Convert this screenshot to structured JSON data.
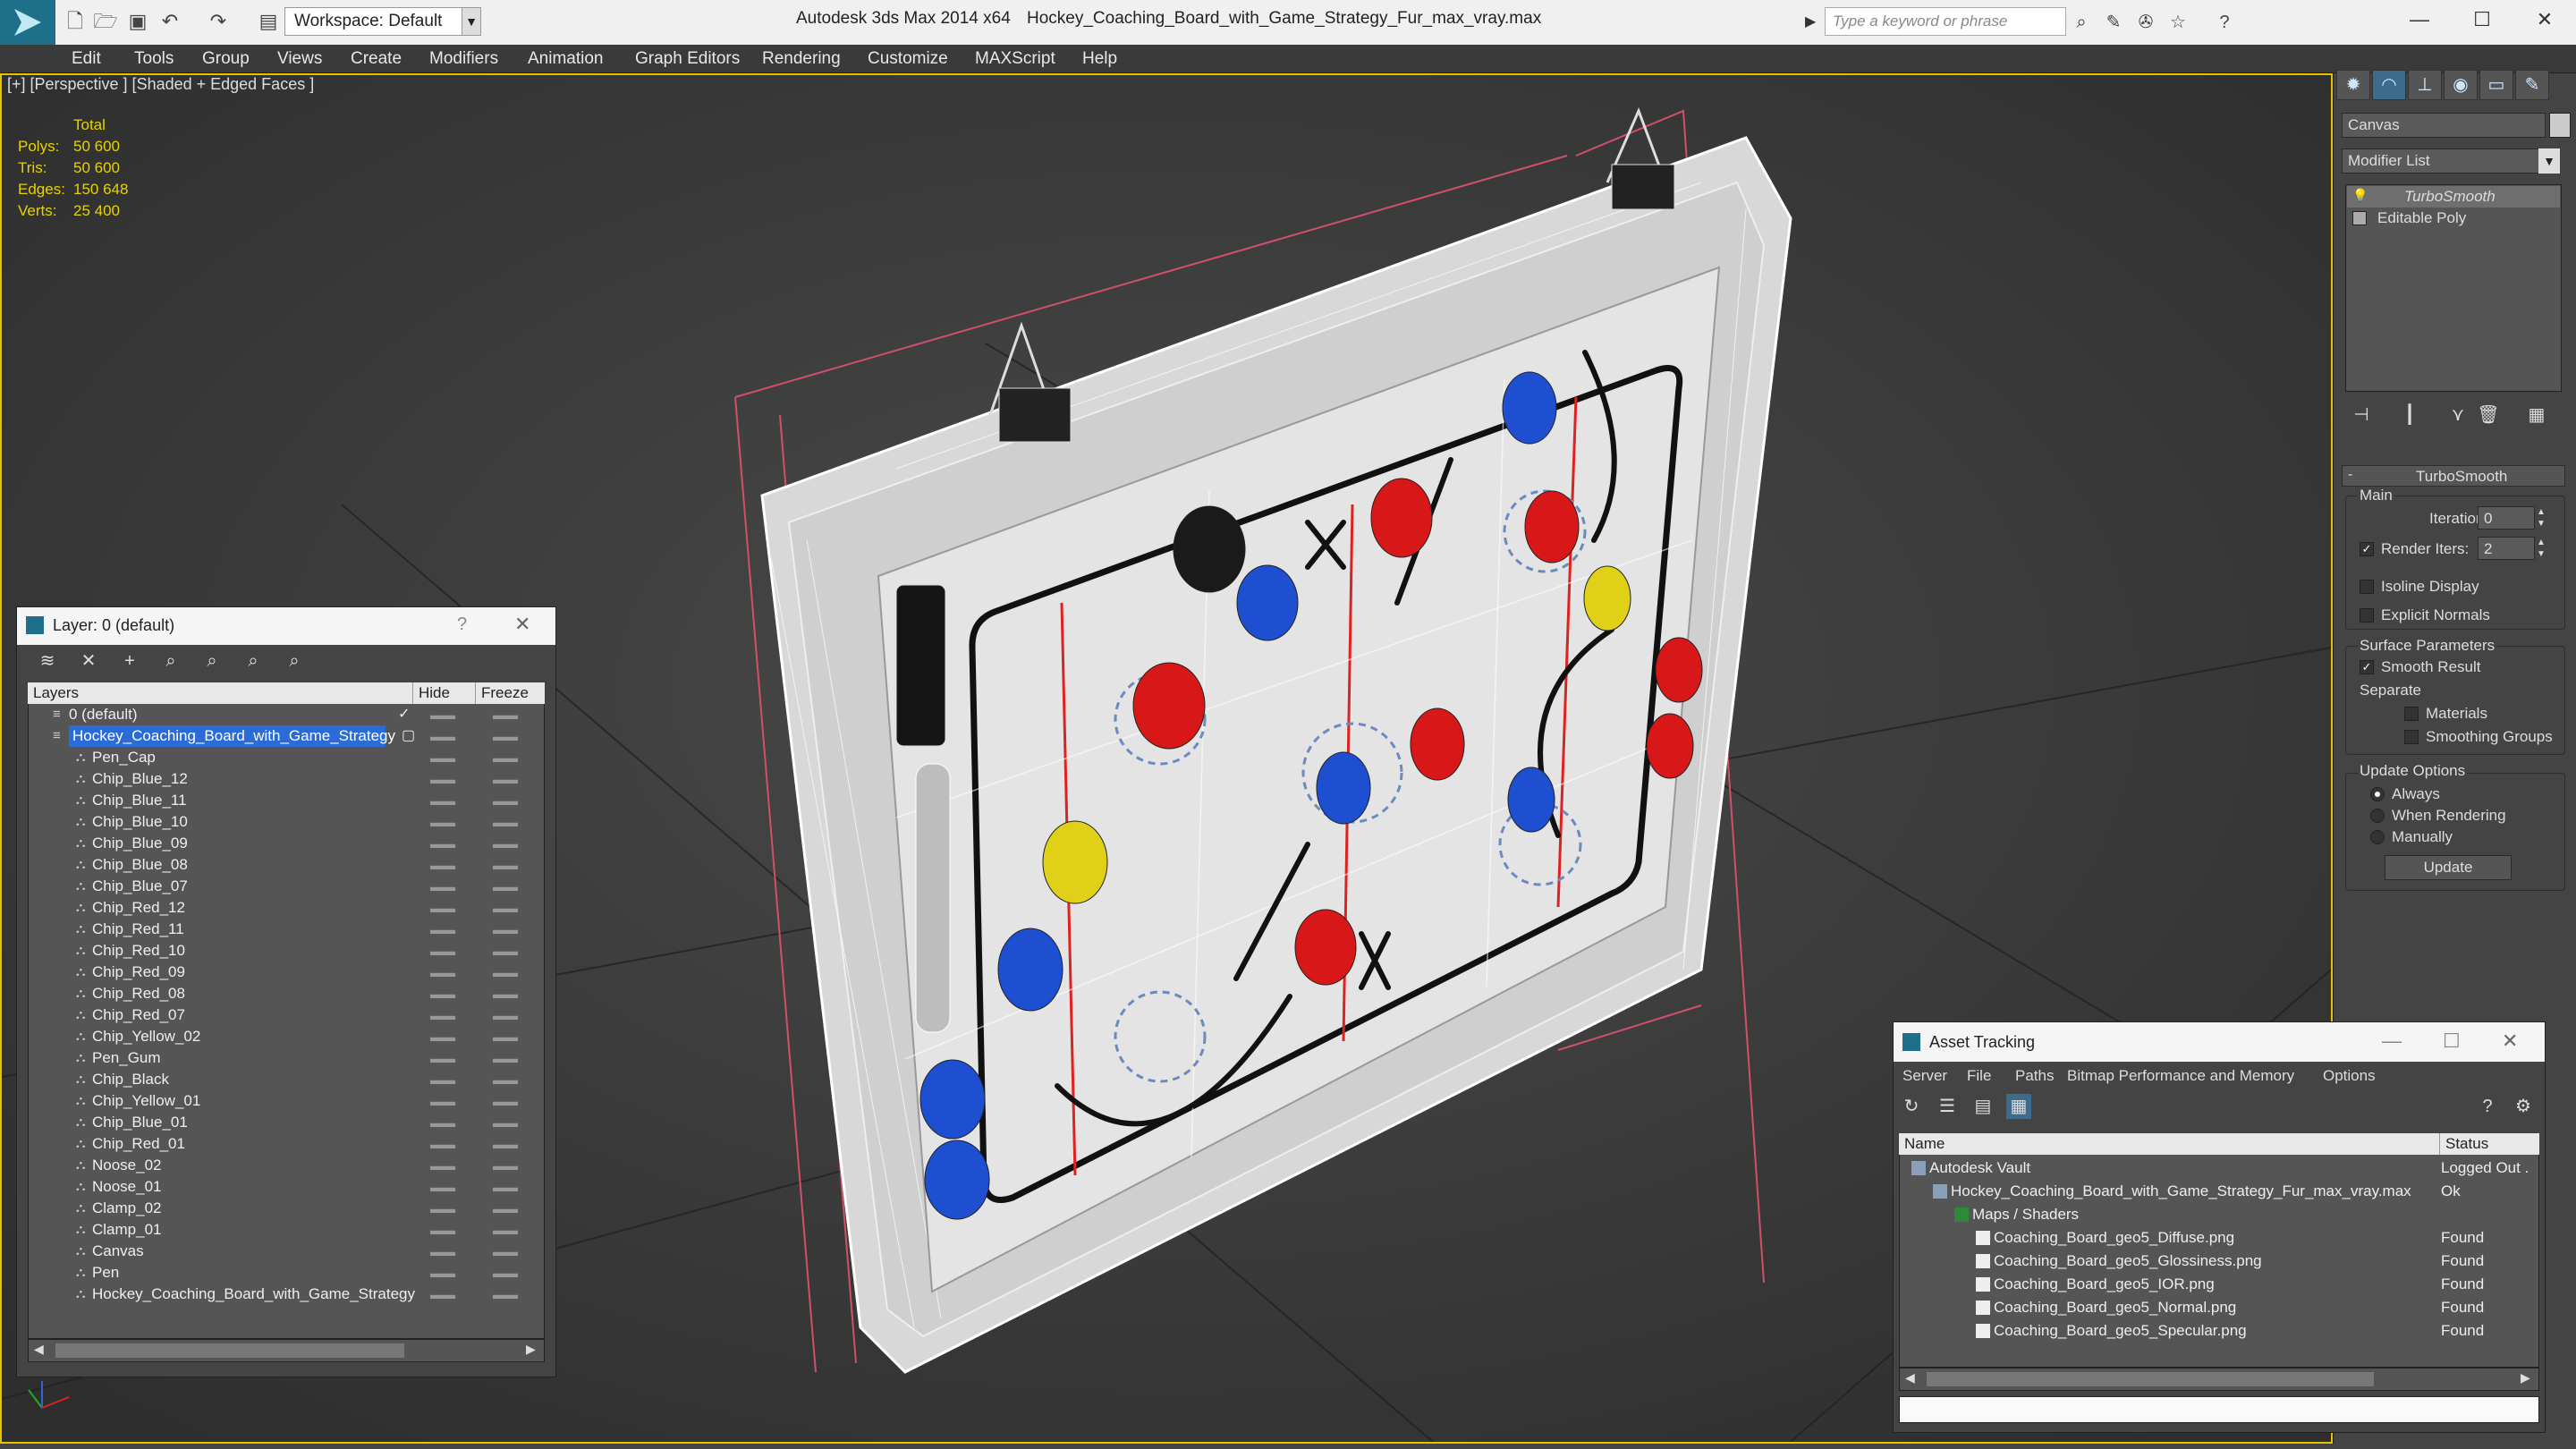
{
  "titlebar": {
    "workspace": "Workspace: Default",
    "app_title": "Autodesk 3ds Max  2014 x64",
    "file_title": "Hockey_Coaching_Board_with_Game_Strategy_Fur_max_vray.max",
    "search_placeholder": "Type a keyword or phrase"
  },
  "menus": [
    "Edit",
    "Tools",
    "Group",
    "Views",
    "Create",
    "Modifiers",
    "Animation",
    "Graph Editors",
    "Rendering",
    "Customize",
    "MAXScript",
    "Help"
  ],
  "viewport": {
    "label": "[+] [Perspective ] [Shaded + Edged Faces ]",
    "stats_header": "Total",
    "stats": [
      {
        "label": "Polys:",
        "value": "50 600"
      },
      {
        "label": "Tris:",
        "value": "50 600"
      },
      {
        "label": "Edges:",
        "value": "150 648"
      },
      {
        "label": "Verts:",
        "value": "25 400"
      }
    ]
  },
  "command_panel": {
    "object_name": "Canvas",
    "modifier_list": "Modifier List",
    "stack": [
      "TurboSmooth",
      "Editable Poly"
    ],
    "rollout_title": "TurboSmooth",
    "main_label": "Main",
    "iterations_label": "Iterations:",
    "iterations_value": "0",
    "render_iters_label": "Render Iters:",
    "render_iters_value": "2",
    "isoline_display": "Isoline Display",
    "explicit_normals": "Explicit Normals",
    "surface_params": "Surface Parameters",
    "smooth_result": "Smooth Result",
    "separate": "Separate",
    "materials": "Materials",
    "smoothing_groups": "Smoothing Groups",
    "update_options": "Update Options",
    "always": "Always",
    "when_rendering": "When Rendering",
    "manually": "Manually",
    "update_button": "Update"
  },
  "layer_dialog": {
    "title": "Layer: 0 (default)",
    "help": "?",
    "col_layers": "Layers",
    "col_hide": "Hide",
    "col_freeze": "Freeze",
    "default_layer": "0 (default)",
    "selected_layer": "Hockey_Coaching_Board_with_Game_Strategy",
    "objects": [
      "Pen_Cap",
      "Chip_Blue_12",
      "Chip_Blue_11",
      "Chip_Blue_10",
      "Chip_Blue_09",
      "Chip_Blue_08",
      "Chip_Blue_07",
      "Chip_Red_12",
      "Chip_Red_11",
      "Chip_Red_10",
      "Chip_Red_09",
      "Chip_Red_08",
      "Chip_Red_07",
      "Chip_Yellow_02",
      "Pen_Gum",
      "Chip_Black",
      "Chip_Yellow_01",
      "Chip_Blue_01",
      "Chip_Red_01",
      "Noose_02",
      "Noose_01",
      "Clamp_02",
      "Clamp_01",
      "Canvas",
      "Pen",
      "Hockey_Coaching_Board_with_Game_Strategy"
    ]
  },
  "asset_dialog": {
    "title": "Asset Tracking",
    "menus": [
      "Server",
      "File",
      "Paths",
      "Bitmap Performance and Memory",
      "Options"
    ],
    "col_name": "Name",
    "col_status": "Status",
    "rows": [
      {
        "name": "Autodesk Vault",
        "status": "Logged Out .",
        "indent": 1
      },
      {
        "name": "Hockey_Coaching_Board_with_Game_Strategy_Fur_max_vray.max",
        "status": "Ok",
        "indent": 2
      },
      {
        "name": "Maps / Shaders",
        "status": "",
        "indent": 3
      },
      {
        "name": "Coaching_Board_geo5_Diffuse.png",
        "status": "Found",
        "indent": 4
      },
      {
        "name": "Coaching_Board_geo5_Glossiness.png",
        "status": "Found",
        "indent": 4
      },
      {
        "name": "Coaching_Board_geo5_IOR.png",
        "status": "Found",
        "indent": 4
      },
      {
        "name": "Coaching_Board_geo5_Normal.png",
        "status": "Found",
        "indent": 4
      },
      {
        "name": "Coaching_Board_geo5_Specular.png",
        "status": "Found",
        "indent": 4
      }
    ]
  }
}
